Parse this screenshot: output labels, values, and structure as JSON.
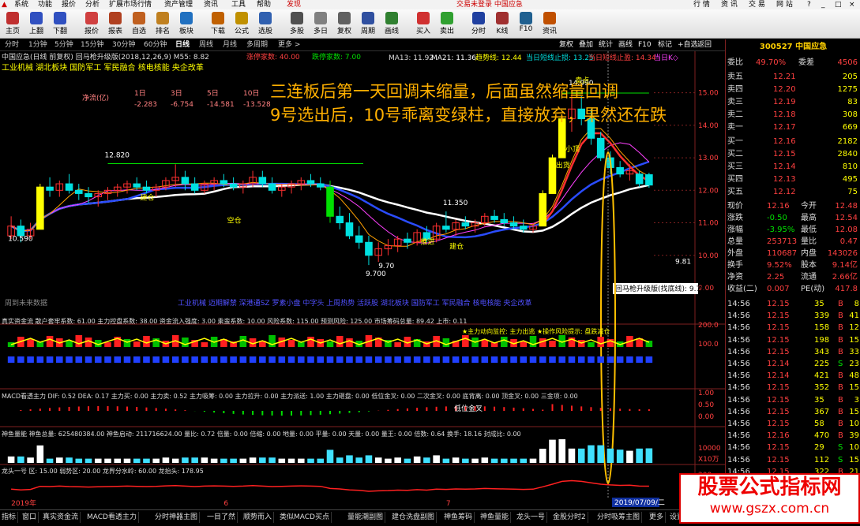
{
  "menu": {
    "items": [
      "系统",
      "功能",
      "报价",
      "分析",
      "扩展市场行情",
      "资产管理",
      "资讯",
      "工具",
      "帮助",
      "发现"
    ],
    "status": "交易未登录 中国应急",
    "right": [
      "行 情",
      "资 讯",
      "交 易",
      "网 站"
    ]
  },
  "toolbar": [
    "主页",
    "上翻",
    "下翻",
    "报价",
    "报表",
    "自选",
    "排名",
    "板块",
    "下载",
    "公式",
    "选股",
    "多股",
    "多日",
    "复权",
    "周期",
    "画线",
    "买入",
    "卖出",
    "分时",
    "K线",
    "F10",
    "资讯"
  ],
  "periods": [
    "分时",
    "1分钟",
    "5分钟",
    "15分钟",
    "30分钟",
    "60分钟",
    "日线",
    "周线",
    "月线",
    "多周期",
    "更多 >"
  ],
  "period_right": [
    "复权",
    "叠加",
    "统计",
    "画线",
    "F10",
    "标记",
    "+自选",
    "返回"
  ],
  "main": {
    "title": "中国应急(日线 前复权) 回马枪升级版(2018,12,26,9) M55: 8.82",
    "limit_down": "涨停家数: 40.00",
    "limit_up": "跌停家数: 7.00",
    "ma13": "MA13: 11.92",
    "ma21": "MA21: 11.36",
    "trend": "趋势线: 12.44",
    "short_line": "当日短线止损: 13.25",
    "short_win": "当日短线止盈: 14.34",
    "today": "当日K◇",
    "sectors": "工业机械 湖北板块 国防军工 军民融合 核电核能 央企改革",
    "net_flow_label": "净流(亿)",
    "net_flow_periods": [
      "1日",
      "3日",
      "5日",
      "10日"
    ],
    "net_flow_values": [
      "-2.283",
      "-6.754",
      "-14.581",
      "-13.528"
    ],
    "annotation": [
      "三连板后第一天回调未缩量，后面虽然缩量回调",
      "9号选出后，10号乖离变绿柱，直接放弃，果然还在跌"
    ],
    "labels": [
      "10.590",
      "12.820",
      "9.700",
      "11.350",
      "14.990",
      "建仓",
      "空仓",
      "推进",
      "出货",
      "建仓",
      "小顶",
      "卖点",
      "14.88",
      "9.70",
      "9.81"
    ],
    "tooltip": "回马枪升级版(找底线): 9.70",
    "cursor_date": "2019/07/09/二",
    "x_labels": [
      "2019年",
      "6",
      "7"
    ],
    "sub_sectors": "工业机械 迈期解禁 深港通SZ 罗素小盘 中字头 上周热势 活跃股 湖北板块 国防军工 军民融合 核电核能 央企改革",
    "weekly_note": "周到未来数据"
  },
  "indicators": {
    "capital": "真实资金流  散户套牢系数: 61.00  主力控盘系数: 38.00  资金流入强度: 3.00  乘蛮系数: 10.00  风险系数: 115.00  预测风险: 125.00  市场筹码总量: 89.42  上市: 0.11",
    "capital_note": "★主力动向监控: 主力出逃  ★操作风险提示: 盘跌减仓",
    "macd": "MACD看透主力  DIF: 0.52  DEA: 0.17  主力买: 0.00  主力卖: 0.52  主力吸筹: 0.00  主力拉升: 0.00  主力派送: 1.00  主力砸盘: 0.00  低位金叉: 0.00  二次金叉: 0.00  底背离: 0.00  顶金叉: 0.00  三金项: 0.00",
    "macd_label": "低位金叉",
    "chip": "神鱼量能  神鱼总量: 625480384.00  神鱼启动: 211716624.00  量比: 0.72  倍量: 0.00  倍缩: 0.00  地量: 0.00  平量: 0.00  天量: 0.00  量王: 0.00  倍数: 0.64  换手: 18.16  封成比: 0.00",
    "dragon": "龙头一号  区: 15.00  弱势区: 20.00  龙界分水岭: 60.00  龙抬头: 178.95",
    "y_ticks_main": [
      "15.00",
      "14.00",
      "13.00",
      "12.00",
      "11.00",
      "10.00",
      "9.00"
    ],
    "y_ticks_cap": [
      "200.0",
      "100.0"
    ],
    "y_ticks_macd": [
      "1.00",
      "0.50",
      "0.00"
    ],
    "y_ticks_vol": [
      "10000",
      "X10万"
    ],
    "y_ticks_dragon": [
      "200",
      "100"
    ]
  },
  "quote": {
    "code": "300527 中国应急",
    "wei_bi": [
      "委比",
      "49.70%",
      "委差",
      "4506"
    ],
    "asks": [
      [
        "卖五",
        "12.21",
        "205"
      ],
      [
        "卖四",
        "12.20",
        "1275"
      ],
      [
        "卖三",
        "12.19",
        "83"
      ],
      [
        "卖二",
        "12.18",
        "308"
      ],
      [
        "卖一",
        "12.17",
        "669"
      ]
    ],
    "bids": [
      [
        "买一",
        "12.16",
        "2182"
      ],
      [
        "买二",
        "12.15",
        "2840"
      ],
      [
        "买三",
        "12.14",
        "810"
      ],
      [
        "买四",
        "12.13",
        "495"
      ],
      [
        "买五",
        "12.12",
        "75"
      ]
    ],
    "stats": [
      [
        "现价",
        "12.16",
        "今开",
        "12.48"
      ],
      [
        "涨跌",
        "-0.50",
        "最高",
        "12.54"
      ],
      [
        "涨幅",
        "-3.95%",
        "最低",
        "12.08"
      ],
      [
        "总量",
        "253713",
        "量比",
        "0.47"
      ],
      [
        "外盘",
        "110687",
        "内盘",
        "143026"
      ],
      [
        "换手",
        "9.52%",
        "股本",
        "9.14亿"
      ],
      [
        "净资",
        "2.25",
        "流通",
        "2.66亿"
      ],
      [
        "收益(二)",
        "0.007",
        "PE(动)",
        "417.8"
      ]
    ],
    "ticks": [
      [
        "14:56",
        "12.15",
        "35",
        "B",
        "8"
      ],
      [
        "14:56",
        "12.15",
        "339",
        "B",
        "41"
      ],
      [
        "14:56",
        "12.15",
        "158",
        "B",
        "12"
      ],
      [
        "14:56",
        "12.15",
        "198",
        "B",
        "15"
      ],
      [
        "14:56",
        "12.15",
        "343",
        "B",
        "33"
      ],
      [
        "14:56",
        "12.14",
        "225",
        "S",
        "23"
      ],
      [
        "14:56",
        "12.14",
        "421",
        "B",
        "48"
      ],
      [
        "14:56",
        "12.15",
        "352",
        "B",
        "15"
      ],
      [
        "14:56",
        "12.15",
        "35",
        "B",
        "3"
      ],
      [
        "14:56",
        "12.15",
        "367",
        "B",
        "15"
      ],
      [
        "14:56",
        "12.15",
        "58",
        "B",
        "10"
      ],
      [
        "14:56",
        "12.16",
        "470",
        "B",
        "39"
      ],
      [
        "14:56",
        "12.15",
        "29",
        "S",
        "10"
      ],
      [
        "14:56",
        "12.15",
        "112",
        "S",
        "15"
      ],
      [
        "14:56",
        "12.15",
        "322",
        "B",
        "21"
      ],
      [
        "14:56",
        "12.15",
        "164",
        "B",
        "14"
      ],
      [
        "14:56",
        "12.15",
        "243",
        "S",
        "22"
      ],
      [
        "14:56",
        "12.15",
        "170",
        "S",
        "19"
      ]
    ]
  },
  "bottom_tabs": [
    "指标",
    "窗口",
    "真实资金流",
    "MACD看透主力",
    "分时神器主图",
    "一目了然",
    "顺势而入",
    "类似MACD买点",
    "量能潮副图",
    "建仓洗盘副图",
    "神鱼筹码",
    "神鱼量能",
    "龙头一号",
    "金股分时2",
    "分时吸筹主图",
    "更多",
    "设置"
  ],
  "watermark": {
    "title": "股票公式指标网",
    "url": "www.gszx.com.cn"
  },
  "colors": {
    "up": "#ff3030",
    "down": "#00e0e0",
    "yellow": "#ffff00",
    "magenta": "#ff40ff",
    "white": "#ffffff",
    "blue": "#2a4cff",
    "annotation": "#ffb000"
  },
  "chart_data": {
    "type": "candlestick",
    "ylim": [
      9.0,
      15.5
    ],
    "candles": [
      [
        10.6,
        11.2,
        10.5,
        10.9
      ],
      [
        10.9,
        11.1,
        10.4,
        10.6
      ],
      [
        10.6,
        11.0,
        10.5,
        10.8
      ],
      [
        10.8,
        12.2,
        10.8,
        12.1
      ],
      [
        12.1,
        12.4,
        11.8,
        12.0
      ],
      [
        12.0,
        12.3,
        11.8,
        12.2
      ],
      [
        12.2,
        12.5,
        11.9,
        12.0
      ],
      [
        12.0,
        12.2,
        11.7,
        11.9
      ],
      [
        11.9,
        12.1,
        11.6,
        11.8
      ],
      [
        11.8,
        12.0,
        11.5,
        11.9
      ],
      [
        11.9,
        12.1,
        11.7,
        12.0
      ],
      [
        12.0,
        12.2,
        11.8,
        12.1
      ],
      [
        12.1,
        12.3,
        11.9,
        12.2
      ],
      [
        12.2,
        12.4,
        12.0,
        12.1
      ],
      [
        12.1,
        12.3,
        11.9,
        12.0
      ],
      [
        12.0,
        12.2,
        11.8,
        12.1
      ],
      [
        12.1,
        12.4,
        12.0,
        12.3
      ],
      [
        12.3,
        12.8,
        12.1,
        12.4
      ],
      [
        12.4,
        12.6,
        12.0,
        12.2
      ],
      [
        12.2,
        12.4,
        11.9,
        12.0
      ],
      [
        12.0,
        12.3,
        11.9,
        12.2
      ],
      [
        12.2,
        12.4,
        12.0,
        12.3
      ],
      [
        12.3,
        12.5,
        12.1,
        12.2
      ],
      [
        12.2,
        12.4,
        12.0,
        12.1
      ],
      [
        12.1,
        12.3,
        11.9,
        12.2
      ],
      [
        12.2,
        12.6,
        12.1,
        12.4
      ],
      [
        12.4,
        12.6,
        12.1,
        12.2
      ],
      [
        12.2,
        12.4,
        11.9,
        12.0
      ],
      [
        12.0,
        12.2,
        11.8,
        12.1
      ],
      [
        12.1,
        12.3,
        11.9,
        12.2
      ],
      [
        12.2,
        12.4,
        12.0,
        12.3
      ],
      [
        12.3,
        12.5,
        12.1,
        12.2
      ],
      [
        12.2,
        12.4,
        12.0,
        12.1
      ],
      [
        12.1,
        12.3,
        11.0,
        11.2
      ],
      [
        11.2,
        11.5,
        10.8,
        11.0
      ],
      [
        11.0,
        11.3,
        10.5,
        10.6
      ],
      [
        10.6,
        10.9,
        10.2,
        10.4
      ],
      [
        10.4,
        10.6,
        9.7,
        10.0
      ],
      [
        10.0,
        10.4,
        9.8,
        10.2
      ],
      [
        10.2,
        10.5,
        10.0,
        10.3
      ],
      [
        10.3,
        10.6,
        10.1,
        10.5
      ],
      [
        10.5,
        10.7,
        10.2,
        10.4
      ],
      [
        10.4,
        10.8,
        10.3,
        10.7
      ],
      [
        10.7,
        10.9,
        10.4,
        10.5
      ],
      [
        10.5,
        11.0,
        10.4,
        10.9
      ],
      [
        10.9,
        11.35,
        10.7,
        10.8
      ],
      [
        10.8,
        11.1,
        10.6,
        11.0
      ],
      [
        11.0,
        11.2,
        10.8,
        10.9
      ],
      [
        10.9,
        11.1,
        10.7,
        11.0
      ],
      [
        11.0,
        11.3,
        10.9,
        11.2
      ],
      [
        11.2,
        11.4,
        11.0,
        11.1
      ],
      [
        11.1,
        11.3,
        10.9,
        11.0
      ],
      [
        11.0,
        11.2,
        10.8,
        10.9
      ],
      [
        10.9,
        11.1,
        10.7,
        10.8
      ],
      [
        10.8,
        11.0,
        10.7,
        10.9
      ],
      [
        10.9,
        12.0,
        10.9,
        11.9
      ],
      [
        11.9,
        13.1,
        11.9,
        13.0
      ],
      [
        13.0,
        14.3,
        13.0,
        14.2
      ],
      [
        14.2,
        15.0,
        13.8,
        14.5
      ],
      [
        14.5,
        14.9,
        14.0,
        14.2
      ],
      [
        14.2,
        14.5,
        13.4,
        13.6
      ],
      [
        13.6,
        13.8,
        12.9,
        13.0
      ],
      [
        13.0,
        13.2,
        12.5,
        12.7
      ],
      [
        12.7,
        12.9,
        12.4,
        12.5
      ],
      [
        12.5,
        12.8,
        12.3,
        12.6
      ],
      [
        12.5,
        12.6,
        12.1,
        12.2
      ],
      [
        12.48,
        12.54,
        12.08,
        12.16
      ]
    ]
  }
}
